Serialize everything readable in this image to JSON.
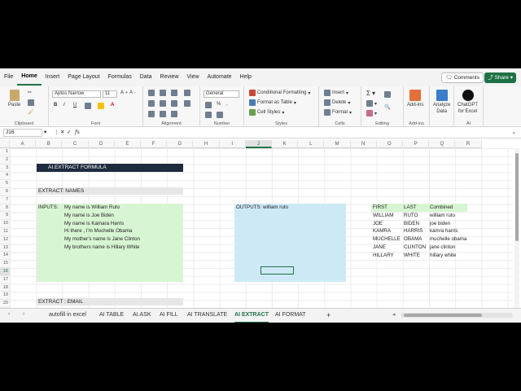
{
  "menu": {
    "tabs": [
      "File",
      "Home",
      "Insert",
      "Page Layout",
      "Formulas",
      "Data",
      "Review",
      "View",
      "Automate",
      "Help"
    ],
    "active_tab": "Home",
    "comments_label": "Comments",
    "share_label": "Share"
  },
  "ribbon": {
    "clipboard": {
      "paste": "Paste",
      "label": "Clipboard"
    },
    "font": {
      "name": "Aptos Narrow",
      "size": "11",
      "label": "Font"
    },
    "alignment": {
      "label": "Alignment"
    },
    "number": {
      "format": "General",
      "label": "Number"
    },
    "styles": {
      "conditional": "Conditional Formatting",
      "format_table": "Format as Table",
      "cell_styles": "Cell Styles",
      "label": "Styles"
    },
    "cells": {
      "insert": "Insert",
      "delete": "Delete",
      "format": "Format",
      "label": "Cells"
    },
    "editing": {
      "label": "Editing"
    },
    "addins": {
      "addins": "Add-ins",
      "label": "Add-ins"
    },
    "analyze": {
      "line1": "Analyze",
      "line2": "Data"
    },
    "chatgpt": {
      "line1": "ChatGPT",
      "line2": "for Excel",
      "label": "AI"
    }
  },
  "formula_bar": {
    "name_box": "J16",
    "fx": "fx",
    "value": ""
  },
  "columns": [
    "A",
    "B",
    "C",
    "D",
    "E",
    "F",
    "G",
    "H",
    "I",
    "J",
    "K",
    "L",
    "M",
    "N",
    "O",
    "P",
    "Q",
    "R"
  ],
  "selected_column": "J",
  "rows": [
    "1",
    "2",
    "3",
    "4",
    "5",
    "6",
    "7",
    "8",
    "9",
    "10",
    "11",
    "12",
    "13",
    "14",
    "15",
    "16",
    "17",
    "18",
    "19",
    "20"
  ],
  "selected_row": "16",
  "sheet": {
    "title": "AI.EXTRACT FORMULA",
    "extract_names": "EXTRACT:   NAMES",
    "inputs_label": "INPUTS:",
    "inputs": [
      "My name is William Ruto",
      "My name is Joe Biden",
      "My name is Kamara Harris",
      "Hi there , I'm Muchelle Obama",
      "My mother's name is Jane Clinton",
      "My brothers name is Hillary White"
    ],
    "outputs_label": "OUTPUTS:",
    "outputs_value": "william ruto",
    "table": {
      "headers": [
        "FIRST",
        "LAST",
        "Combined"
      ],
      "rows": [
        [
          "WILLIAM",
          "RUTO",
          "william ruto"
        ],
        [
          "JOE",
          "BIDEN",
          "joe biden"
        ],
        [
          "KAMRA",
          "HARRIS",
          "kamra harris"
        ],
        [
          "MUCHELLE",
          "OBAMA",
          "muchelle obama"
        ],
        [
          "JANE",
          "CLINTON",
          "jane clinton"
        ],
        [
          "HILLARY",
          "WHITE",
          "hillary white"
        ]
      ]
    },
    "extract_email": "EXTRACT : EMAIL"
  },
  "sheet_tabs": [
    "autofill in excel",
    "AI TABLE",
    "AI.ASK",
    "AI FILL",
    "AI TRANSLATE",
    "AI EXTRACT",
    "AI FORMAT"
  ],
  "active_sheet": "AI EXTRACT",
  "add_sheet": "+"
}
